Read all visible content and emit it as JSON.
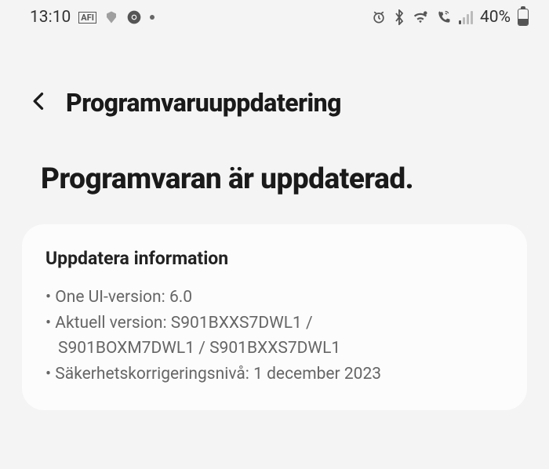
{
  "status": {
    "time": "13:10",
    "notif_badge": "AFI",
    "battery_pct": "40%"
  },
  "header": {
    "title": "Programvaruuppdatering"
  },
  "main": {
    "status_message": "Programvaran är uppdaterad."
  },
  "card": {
    "title": "Uppdatera information",
    "one_ui_label": "One UI-version: ",
    "one_ui_value": "6.0",
    "current_version_label": "Aktuell version: ",
    "current_version_value_line1": "S901BXXS7DWL1 /",
    "current_version_value_line2": "S901BOXM7DWL1 / S901BXXS7DWL1",
    "security_label": "Säkerhetskorrigeringsnivå: ",
    "security_value": "1 december 2023"
  }
}
